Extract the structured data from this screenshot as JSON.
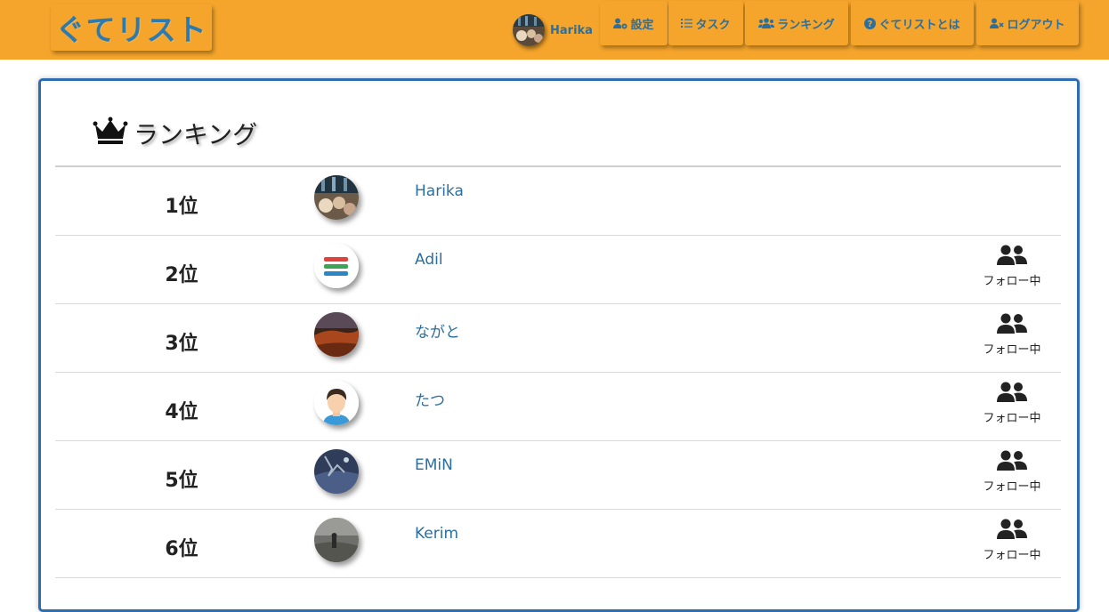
{
  "header": {
    "logo_text": "ぐてリスト",
    "brand_color": "#f5a52b",
    "user": {
      "name": "Harika",
      "avatar": "photo-avatar"
    },
    "nav": [
      {
        "label": "設定",
        "icon": "user-gear-icon"
      },
      {
        "label": "タスク",
        "icon": "list-icon"
      },
      {
        "label": "ランキング",
        "icon": "users-icon"
      },
      {
        "label": "ぐてリストとは",
        "icon": "question-circle-icon"
      },
      {
        "label": "ログアウト",
        "icon": "user-times-icon"
      }
    ]
  },
  "ranking": {
    "title": "ランキング",
    "title_icon": "crown-icon",
    "rows": [
      {
        "rank": "1位",
        "name": "Harika",
        "avatar": "photo-avatar",
        "follow_label": ""
      },
      {
        "rank": "2位",
        "name": "Adil",
        "avatar": "stripes-avatar",
        "follow_label": "フォロー中"
      },
      {
        "rank": "3位",
        "name": "ながと",
        "avatar": "landscape-avatar",
        "follow_label": "フォロー中"
      },
      {
        "rank": "4位",
        "name": "たつ",
        "avatar": "person-avatar",
        "follow_label": "フォロー中"
      },
      {
        "rank": "5位",
        "name": "EMiN",
        "avatar": "night-avatar",
        "follow_label": "フォロー中"
      },
      {
        "rank": "6位",
        "name": "Kerim",
        "avatar": "gray-avatar",
        "follow_label": "フォロー中"
      }
    ]
  }
}
